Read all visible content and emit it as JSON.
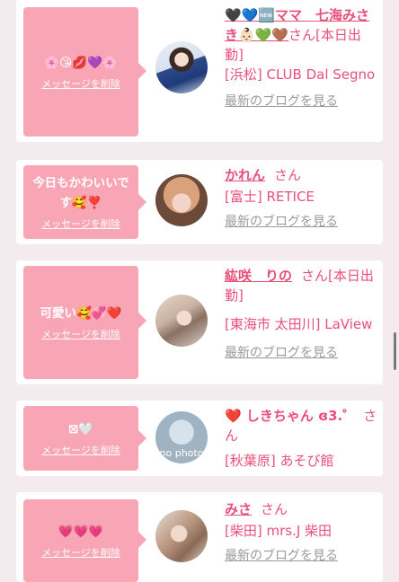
{
  "messages": [
    {
      "message_text": "🌸😘💋💜🌸",
      "delete_label": "メッセージを削除",
      "cast_name": "🖤💙🆕ママ　七海みさき👶🏻💚🤎",
      "honorific": "さん[本日出勤]",
      "shop": "[浜松] CLUB Dal Segno",
      "blog_label": "最新のブログを見る"
    },
    {
      "message_text": "今日もかわいいです🥰❣️",
      "delete_label": "メッセージを削除",
      "cast_name": "かれん",
      "honorific": "さん",
      "shop": "[富士] RETICE",
      "blog_label": "最新のブログを見る"
    },
    {
      "message_text": "可愛い🥰💞❤️",
      "delete_label": "メッセージを削除",
      "cast_name": "紘咲　りの",
      "honorific": "さん[本日出勤]",
      "shop": "[東海市 太田川] LaView",
      "blog_label": "最新のブログを見る"
    },
    {
      "message_text": "⊠🤍",
      "delete_label": "メッセージを削除",
      "cast_name": "❤️ しきちゃん ɞ3.゜",
      "honorific": "さん",
      "shop": "[秋葉原] あそび館",
      "avatar_placeholder": "no photo"
    },
    {
      "message_text": "💗💗💗",
      "delete_label": "メッセージを削除",
      "cast_name": "みさ",
      "honorific": "さん",
      "shop": "[柴田] mrs.J 柴田",
      "blog_label": "最新のブログを見る"
    }
  ],
  "colors": {
    "page_bg": "#f3ebee",
    "card_bg": "#ffffff",
    "message_pink": "#f8a5b5",
    "name_pink": "#e8507a",
    "link_gray": "#9a9a9a"
  }
}
